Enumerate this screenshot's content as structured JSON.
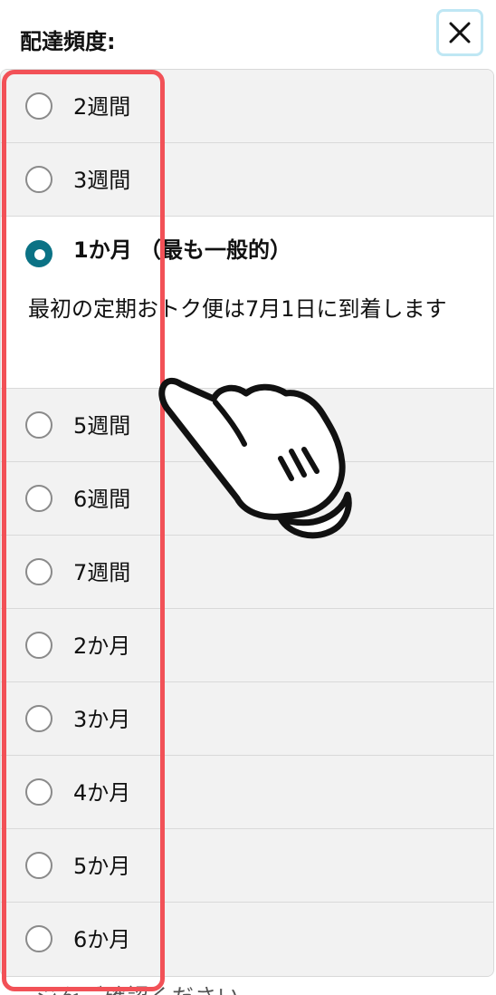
{
  "header": {
    "title": "配達頻度:"
  },
  "close_icon": "close-icon",
  "options": [
    {
      "label": "2週間",
      "selected": false
    },
    {
      "label": "3週間",
      "selected": false
    },
    {
      "label": "1か月 （最も一般的）",
      "selected": true,
      "description": "最初の定期おトク便は7月1日に到着します"
    },
    {
      "label": "5週間",
      "selected": false
    },
    {
      "label": "6週間",
      "selected": false
    },
    {
      "label": "7週間",
      "selected": false
    },
    {
      "label": "2か月",
      "selected": false
    },
    {
      "label": "3か月",
      "selected": false
    },
    {
      "label": "4か月",
      "selected": false
    },
    {
      "label": "5か月",
      "selected": false
    },
    {
      "label": "6か月",
      "selected": false
    }
  ],
  "background": {
    "footer_text": "ジをご確認ください"
  },
  "colors": {
    "highlight": "#f25157",
    "radio_selected": "#0b7285",
    "close_border": "#bfe7f4"
  },
  "overlay": {
    "hand_icon": "pointing-hand-icon"
  }
}
